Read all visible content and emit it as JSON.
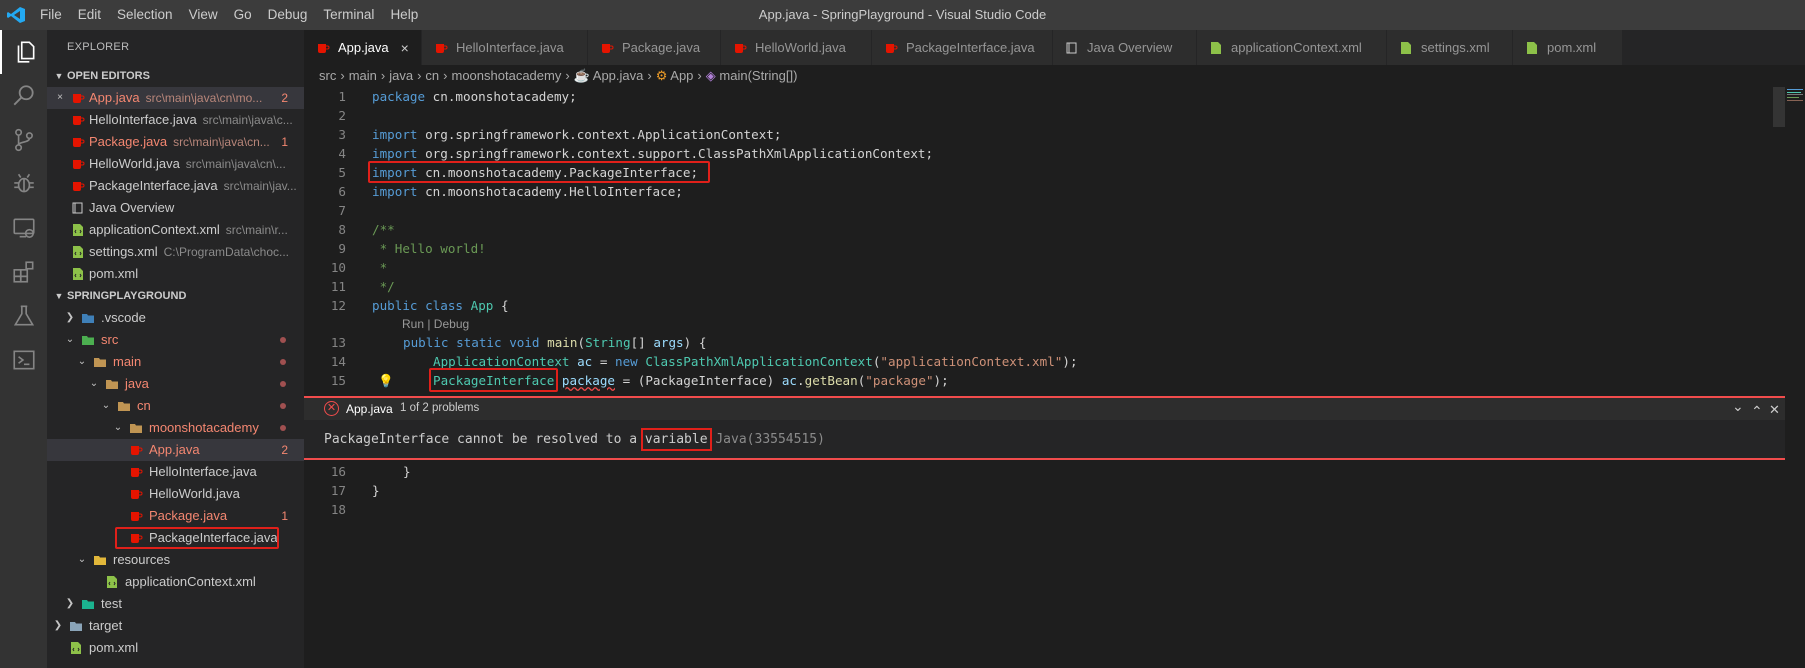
{
  "titlebar": {
    "menu": [
      "File",
      "Edit",
      "Selection",
      "View",
      "Go",
      "Debug",
      "Terminal",
      "Help"
    ],
    "window_title": "App.java - SpringPlayground - Visual Studio Code"
  },
  "activitybar": {
    "icons": [
      "explorer-icon",
      "search-icon",
      "source-control-icon",
      "debug-icon",
      "remote-explorer-icon",
      "extensions-icon",
      "test-icon",
      "terminal-icon"
    ]
  },
  "sidebar": {
    "title": "EXPLORER",
    "open_editors": {
      "header": "OPEN EDITORS",
      "items": [
        {
          "name": "App.java",
          "desc": "src\\main\\java\\cn\\mo...",
          "badge": "2",
          "close": "×"
        },
        {
          "name": "HelloInterface.java",
          "desc": "src\\main\\java\\c...",
          "badge": ""
        },
        {
          "name": "Package.java",
          "desc": "src\\main\\java\\cn...",
          "badge": "1"
        },
        {
          "name": "HelloWorld.java",
          "desc": "src\\main\\java\\cn\\...",
          "badge": ""
        },
        {
          "name": "PackageInterface.java",
          "desc": "src\\main\\jav...",
          "badge": ""
        },
        {
          "name": "Java Overview",
          "desc": "",
          "badge": ""
        },
        {
          "name": "applicationContext.xml",
          "desc": "src\\main\\r...",
          "badge": ""
        },
        {
          "name": "settings.xml",
          "desc": "C:\\ProgramData\\choc...",
          "badge": ""
        },
        {
          "name": "pom.xml",
          "desc": "",
          "badge": ""
        }
      ]
    },
    "project": {
      "header": "SPRINGPLAYGROUND",
      "items": [
        {
          "name": ".vscode"
        },
        {
          "name": "src"
        },
        {
          "name": "main"
        },
        {
          "name": "java"
        },
        {
          "name": "cn"
        },
        {
          "name": "moonshotacademy"
        },
        {
          "name": "App.java",
          "badge": "2"
        },
        {
          "name": "HelloInterface.java"
        },
        {
          "name": "HelloWorld.java"
        },
        {
          "name": "Package.java",
          "badge": "1"
        },
        {
          "name": "PackageInterface.java"
        },
        {
          "name": "resources"
        },
        {
          "name": "applicationContext.xml"
        },
        {
          "name": "test"
        },
        {
          "name": "target"
        },
        {
          "name": "pom.xml"
        }
      ]
    }
  },
  "tabs": [
    {
      "label": "App.java",
      "close": "×"
    },
    {
      "label": "HelloInterface.java"
    },
    {
      "label": "Package.java"
    },
    {
      "label": "HelloWorld.java"
    },
    {
      "label": "PackageInterface.java"
    },
    {
      "label": "Java Overview"
    },
    {
      "label": "applicationContext.xml"
    },
    {
      "label": "settings.xml"
    },
    {
      "label": "pom.xml"
    }
  ],
  "breadcrumb": [
    "src",
    "main",
    "java",
    "cn",
    "moonshotacademy",
    "App.java",
    "App",
    "main(String[])"
  ],
  "editor": {
    "line_numbers": [
      "1",
      "2",
      "3",
      "4",
      "5",
      "6",
      "7",
      "8",
      "9",
      "10",
      "11",
      "12",
      "13",
      "14",
      "15",
      "16",
      "17",
      "18"
    ],
    "codelens": "Run | Debug",
    "t": {
      "package": "package",
      "import": "import",
      "public": "public",
      "class": "class",
      "static": "static",
      "void": "void",
      "new": "new",
      "l1_rest": " cn.moonshotacademy;",
      "l3_rest": " org.springframework.context.ApplicationContext;",
      "l4_rest": " org.springframework.context.support.ClassPathXmlApplicationContext;",
      "l5_rest": " cn.moonshotacademy.PackageInterface;",
      "l6_rest": " cn.moonshotacademy.HelloInterface;",
      "l8": "/**",
      "l9": " * Hello world!",
      "l10": " *",
      "l11": " */",
      "App": "App",
      "brace_open": " {",
      "main": "main",
      "String": "String",
      "l13_mid": "[] ",
      "args": "args",
      "l13_end": ") {",
      "ApplicationContext": "ApplicationContext",
      "ac": "ac",
      "eq": " = ",
      "ClassPathXmlApplicationContext": "ClassPathXmlApplicationContext",
      "paren_open": "(",
      "appctx_str": "\"applicationContext.xml\"",
      "paren_semi": ");",
      "PackageInterface": "PackageInterface",
      "package_var": "package",
      "cast_open": " = (",
      "cast_close": ") ",
      "dot": ".",
      "getBean": "getBean",
      "package_str": "\"package\"",
      "l16": "}",
      "l17": "}"
    }
  },
  "problem_peek": {
    "file": "App.java",
    "count": "1 of 2 problems",
    "msg_before": "PackageInterface cannot be resolved to a ",
    "msg_highlight": "variable",
    "msg_after": " Java(33554515)",
    "next": "⌄",
    "prev": "⌃",
    "close": "✕"
  },
  "colors": {
    "error": "#f48771",
    "accent": "#007acc",
    "highlight_box": "#e0201a"
  }
}
